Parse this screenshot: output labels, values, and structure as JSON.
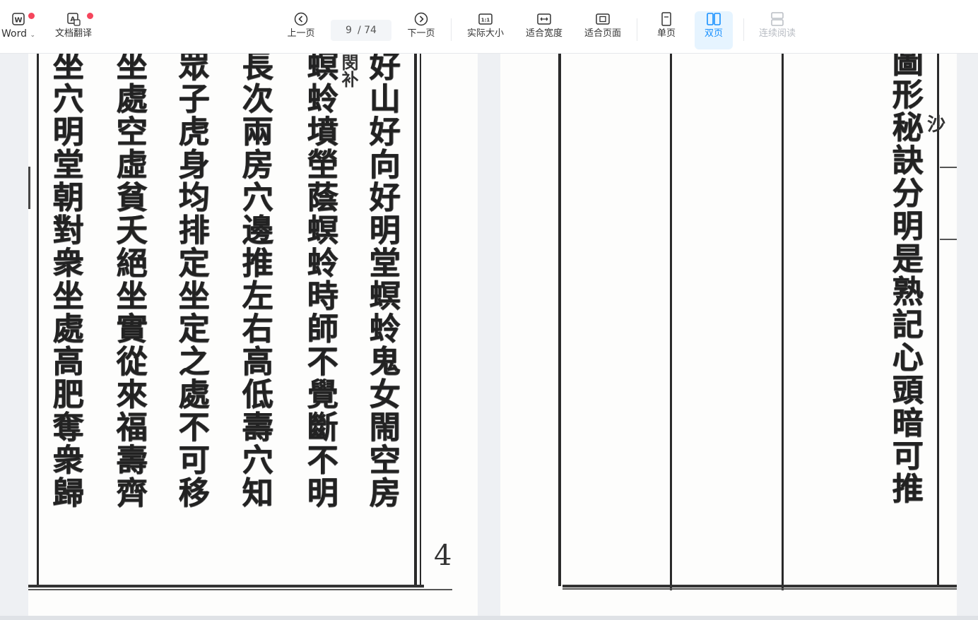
{
  "toolbar": {
    "word_label": "Word",
    "translate_label": "文档翻译",
    "prev_label": "上一页",
    "page_current": "9",
    "page_total": "/ 74",
    "next_label": "下一页",
    "actual_size_label": "实际大小",
    "fit_width_label": "适合宽度",
    "fit_page_label": "适合页面",
    "single_page_label": "单页",
    "double_page_label": "双页",
    "continuous_label": "连续阅读",
    "accent_color": "#1890ff",
    "badge_color": "#f5455c",
    "icons": {
      "word": "word-doc-icon",
      "translate": "translate-icon",
      "prev": "chevron-left-circle-icon",
      "next": "chevron-right-circle-icon",
      "actual": "one-to-one-icon",
      "width": "fit-width-icon",
      "page": "fit-page-icon",
      "single": "single-page-icon",
      "double": "double-page-icon",
      "continuous": "continuous-scroll-icon"
    }
  },
  "document": {
    "left_page": {
      "columns": [
        "好山好向好明堂螟蛉鬼女閙空房",
        "螟蛉墳塋蔭螟蛉時師不覺斷不明",
        "長次兩房穴邊推左右高低壽穴知",
        "眾子虎身均排定坐定之處不可移",
        "坐處空虛貧夭絕坐實從來福壽齊",
        "坐穴明堂朝對衆坐處高肥奪衆歸"
      ],
      "annotation": "閔补",
      "page_number": "4"
    },
    "right_page": {
      "columns": [
        "圖形秘訣分明是熟記心頭暗可推"
      ],
      "annotation": "沙"
    }
  }
}
